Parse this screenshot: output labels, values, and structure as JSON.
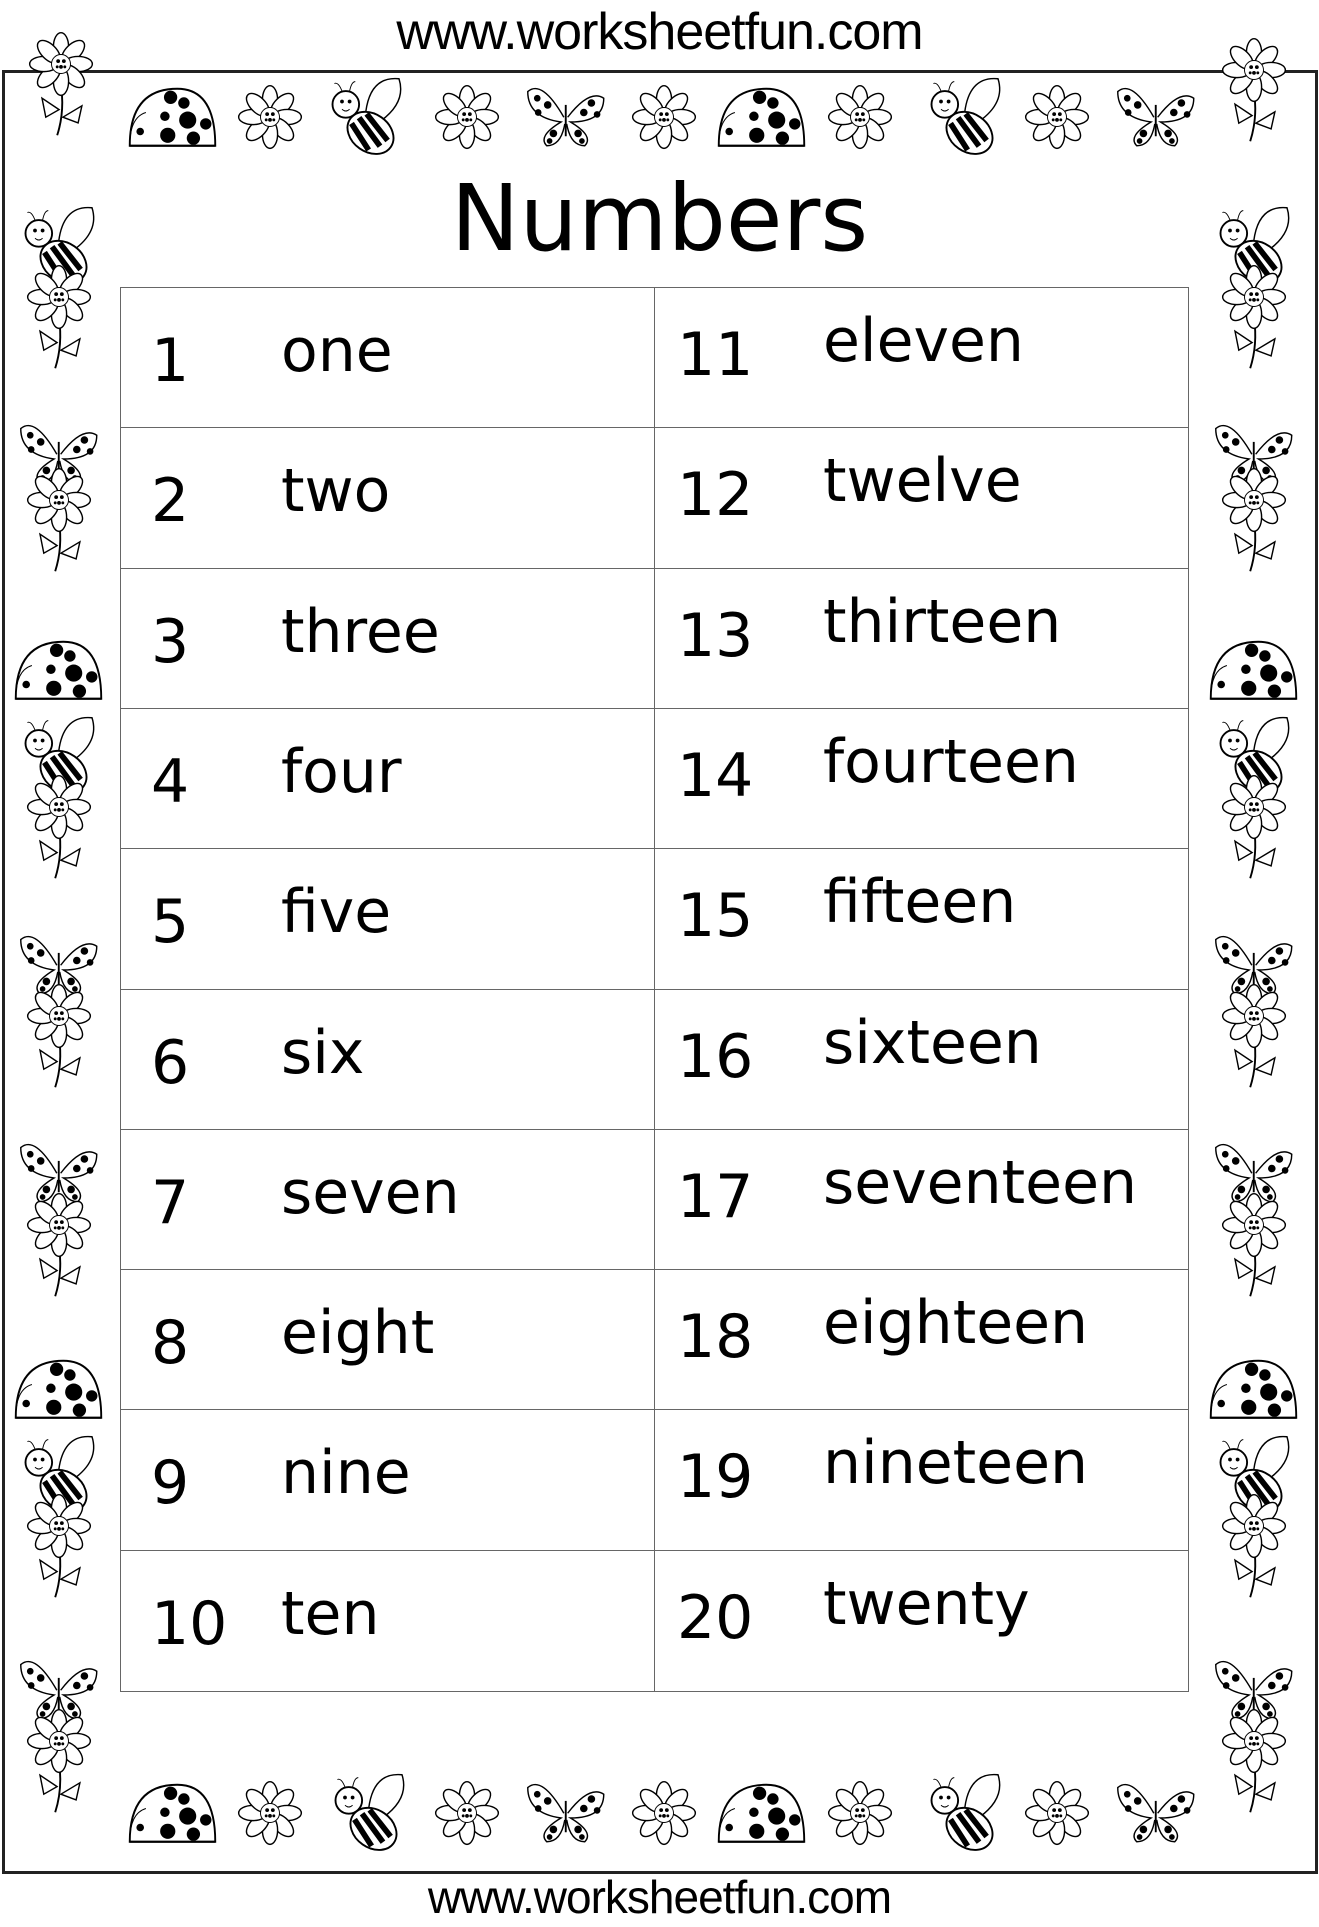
{
  "header": {
    "url": "www.worksheetfun.com"
  },
  "footer": {
    "url": "www.worksheetfun.com"
  },
  "title": "Numbers",
  "numbers": [
    {
      "num": "1",
      "word": "one"
    },
    {
      "num": "2",
      "word": "two"
    },
    {
      "num": "3",
      "word": "three"
    },
    {
      "num": "4",
      "word": "four"
    },
    {
      "num": "5",
      "word": "five"
    },
    {
      "num": "6",
      "word": "six"
    },
    {
      "num": "7",
      "word": "seven"
    },
    {
      "num": "8",
      "word": "eight"
    },
    {
      "num": "9",
      "word": "nine"
    },
    {
      "num": "10",
      "word": "ten"
    },
    {
      "num": "11",
      "word": "eleven"
    },
    {
      "num": "12",
      "word": "twelve"
    },
    {
      "num": "13",
      "word": "thirteen"
    },
    {
      "num": "14",
      "word": "fourteen"
    },
    {
      "num": "15",
      "word": "fifteen"
    },
    {
      "num": "16",
      "word": "sixteen"
    },
    {
      "num": "17",
      "word": "seventeen"
    },
    {
      "num": "18",
      "word": "eighteen"
    },
    {
      "num": "19",
      "word": "nineteen"
    },
    {
      "num": "20",
      "word": "twenty"
    }
  ],
  "border_icons": [
    "flower-icon",
    "ladybug-icon",
    "bee-icon",
    "butterfly-icon"
  ]
}
